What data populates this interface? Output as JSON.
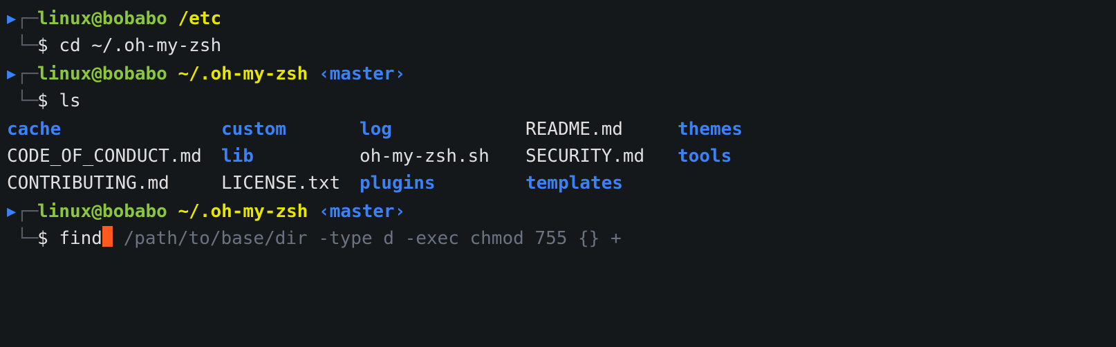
{
  "prompts": [
    {
      "arrow": "▶",
      "topCorner": "┌─",
      "bottomCorner": "└─",
      "userHost": "linux@bobabo",
      "path": "/etc",
      "branch": "",
      "dollar": "$",
      "command": "cd ~/.oh-my-zsh"
    },
    {
      "arrow": "▶",
      "topCorner": "┌─",
      "bottomCorner": "└─",
      "userHost": "linux@bobabo",
      "path": "~/.oh-my-zsh",
      "branch": "‹master›",
      "dollar": "$",
      "command": "ls"
    }
  ],
  "lsGrid": [
    [
      {
        "text": "cache",
        "type": "dir"
      },
      {
        "text": "custom",
        "type": "dir"
      },
      {
        "text": "log",
        "type": "dir"
      },
      {
        "text": "README.md",
        "type": "file"
      },
      {
        "text": "themes",
        "type": "dir"
      }
    ],
    [
      {
        "text": "CODE_OF_CONDUCT.md",
        "type": "file"
      },
      {
        "text": "lib",
        "type": "dir"
      },
      {
        "text": "oh-my-zsh.sh",
        "type": "file"
      },
      {
        "text": "SECURITY.md",
        "type": "file"
      },
      {
        "text": "tools",
        "type": "dir"
      }
    ],
    [
      {
        "text": "CONTRIBUTING.md",
        "type": "file"
      },
      {
        "text": "LICENSE.txt",
        "type": "file"
      },
      {
        "text": "plugins",
        "type": "dir"
      },
      {
        "text": "templates",
        "type": "dir"
      },
      {
        "text": "",
        "type": "file"
      }
    ]
  ],
  "currentPrompt": {
    "arrow": "▶",
    "topCorner": "┌─",
    "bottomCorner": "└─",
    "userHost": "linux@bobabo",
    "path": "~/.oh-my-zsh",
    "branch": "‹master›",
    "dollar": "$",
    "typed": "find",
    "suggestion": " /path/to/base/dir -type d -exec chmod 755 {} +"
  }
}
